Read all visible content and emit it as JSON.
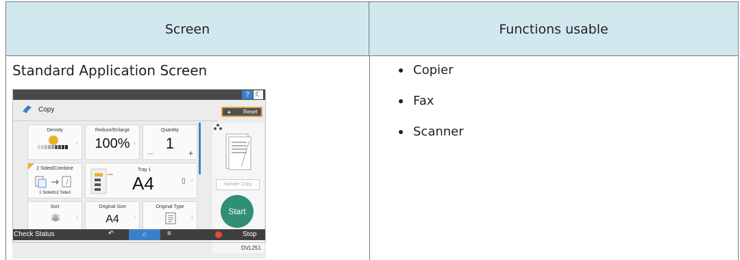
{
  "table": {
    "header_screen": "Screen",
    "header_functions": "Functions usable",
    "row_title": "Standard Application Screen",
    "functions": [
      "Copier",
      "Fax",
      "Scanner"
    ]
  },
  "copier_screen": {
    "help_label": "?",
    "app_title": "Copy",
    "reset_label": "Reset",
    "density_label": "Density",
    "reduce_label": "Reduce/Enlarge",
    "reduce_value": "100%",
    "quantity_label": "Quantity",
    "quantity_value": "1",
    "quantity_minus": "—",
    "quantity_plus": "+",
    "sided_label": "2 Sided/Combine",
    "sided_sub": "1 Sidedto2 Sided",
    "tray_label": "Tray 1",
    "tray_value": "A4",
    "sort_label": "Sort",
    "original_size_label": "Original Size",
    "original_size_value": "A4",
    "original_type_label": "Original Type",
    "sample_copy_label": "Sample Copy",
    "start_label": "Start",
    "check_status_label": "Check Status",
    "stop_label": "Stop",
    "figure_id": "DVL251",
    "accent_color": "#3a7fc9",
    "start_color": "#2f8f75"
  }
}
